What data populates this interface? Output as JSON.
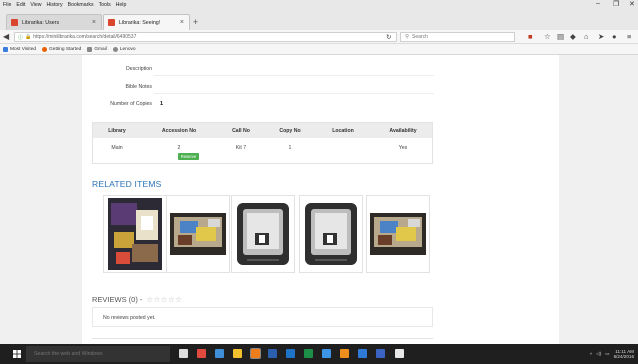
{
  "menu": {
    "items": [
      "File",
      "Edit",
      "View",
      "History",
      "Bookmarks",
      "Tools",
      "Help"
    ]
  },
  "window_controls": {
    "minimize": "–",
    "maximize": "❐",
    "close": "✕"
  },
  "tabs": [
    {
      "title": "Librarika: Users",
      "active": false
    },
    {
      "title": "Librarika: Seeing!",
      "active": true
    }
  ],
  "toolbar": {
    "url": "https://minilibrarika.com/search/detail/6490537",
    "search_placeholder": "Search"
  },
  "bookmarks": [
    {
      "label": "Most Visited",
      "color": "#3b7ddd"
    },
    {
      "label": "Getting Started",
      "color": "#e66000"
    },
    {
      "label": "Gmail",
      "color": "#888888"
    },
    {
      "label": "Lenovo",
      "color": "#888888"
    }
  ],
  "details": [
    {
      "label": "Description",
      "value": ""
    },
    {
      "label": "Bible Notes",
      "value": ""
    },
    {
      "label": "Number of Copies",
      "value": "1"
    }
  ],
  "copies_table": {
    "headers": [
      "Library",
      "Accession No",
      "Call No",
      "Copy No",
      "Location",
      "Availability"
    ],
    "rows": [
      {
        "library": "Main",
        "accession_no": "2",
        "call_no": "Kit 7",
        "copy_no": "1",
        "location": "",
        "availability": "Yes",
        "action_label": "Reserve"
      }
    ]
  },
  "related": {
    "title": "RELATED ITEMS",
    "items": [
      {
        "kind": "box-cover"
      },
      {
        "kind": "kit-photo"
      },
      {
        "kind": "3d-printer"
      },
      {
        "kind": "3d-printer"
      },
      {
        "kind": "kit-photo"
      }
    ]
  },
  "reviews": {
    "title": "REVIEWS (0)",
    "dash": "-",
    "stars": "☆☆☆☆☆",
    "empty_text": "No reviews posted yet."
  },
  "taskbar": {
    "search_placeholder": "Search the web and Windows",
    "icons": [
      {
        "name": "task-view-icon",
        "color": "#dddddd"
      },
      {
        "name": "chrome-icon",
        "color": "#e04a3f"
      },
      {
        "name": "store-icon",
        "color": "#3f8fd8"
      },
      {
        "name": "file-explorer-icon",
        "color": "#f2c12e"
      },
      {
        "name": "firefox-icon",
        "color": "#ef7d1b"
      },
      {
        "name": "word-icon",
        "color": "#2b5fae"
      },
      {
        "name": "outlook-icon",
        "color": "#1e73c6"
      },
      {
        "name": "excel-icon",
        "color": "#1d8f49"
      },
      {
        "name": "edge-icon",
        "color": "#3b96e6"
      },
      {
        "name": "media-icon",
        "color": "#ee8f1d"
      },
      {
        "name": "photos-icon",
        "color": "#2e7ad6"
      },
      {
        "name": "app-icon",
        "color": "#3a63c4"
      },
      {
        "name": "steam-icon",
        "color": "#e8e8e8"
      }
    ],
    "time": "11:11 AM",
    "date": "6/24/2016"
  },
  "colors": {
    "accent": "#2a72b5",
    "reserve": "#4caf50"
  }
}
